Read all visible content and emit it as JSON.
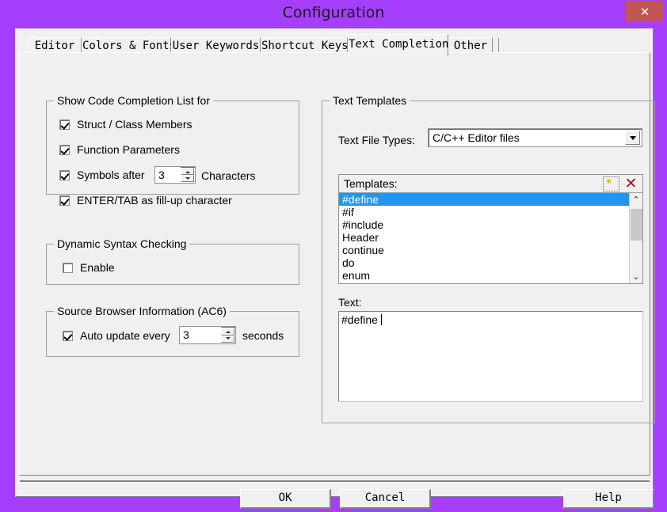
{
  "window": {
    "title": "Configuration",
    "close_label": "✕",
    "accent_purple": "#a63ffd",
    "close_red": "#c15455",
    "face": "#f0f0f0",
    "selection_blue": "#2196f3"
  },
  "tabs": [
    {
      "label": "Editor",
      "active": false
    },
    {
      "label": "Colors & Fonts",
      "active": false
    },
    {
      "label": "User Keywords",
      "active": false
    },
    {
      "label": "Shortcut Keys",
      "active": false
    },
    {
      "label": "Text Completion",
      "active": true
    },
    {
      "label": "Other",
      "active": false
    }
  ],
  "code_completion_group": {
    "title": "Show Code Completion List for",
    "items": [
      {
        "label": "Struct / Class Members",
        "checked": true
      },
      {
        "label": "Function Parameters",
        "checked": true
      },
      {
        "label": "Symbols after",
        "checked": true
      },
      {
        "label": "ENTER/TAB as fill-up character",
        "checked": true
      }
    ],
    "symbols_value": "3",
    "symbols_suffix": "Characters"
  },
  "dynamic_syntax_group": {
    "title": "Dynamic Syntax Checking",
    "enable_label": "Enable",
    "enable_checked": false
  },
  "source_browser_group": {
    "title": "Source Browser Information (AC6)",
    "auto_update_label": "Auto update every",
    "auto_update_checked": true,
    "interval_value": "3",
    "interval_suffix": "seconds"
  },
  "text_templates_group": {
    "title": "Text Templates",
    "file_types_label": "Text File Types:",
    "file_types_value": "C/C++ Editor files",
    "file_types_options": [
      "C/C++ Editor files"
    ],
    "templates_label": "Templates:",
    "new_icon": "new-template-icon",
    "delete_icon": "delete-template-icon",
    "templates": [
      {
        "label": "#define",
        "selected": true
      },
      {
        "label": "#if",
        "selected": false
      },
      {
        "label": "#include",
        "selected": false
      },
      {
        "label": "Header",
        "selected": false
      },
      {
        "label": "continue",
        "selected": false
      },
      {
        "label": "do",
        "selected": false
      },
      {
        "label": "enum",
        "selected": false
      }
    ],
    "text_label": "Text:",
    "text_value": "#define ",
    "scroll_up_glyph": "⌃",
    "scroll_down_glyph": "⌄"
  },
  "buttons": {
    "ok": "OK",
    "cancel": "Cancel",
    "help": "Help"
  }
}
